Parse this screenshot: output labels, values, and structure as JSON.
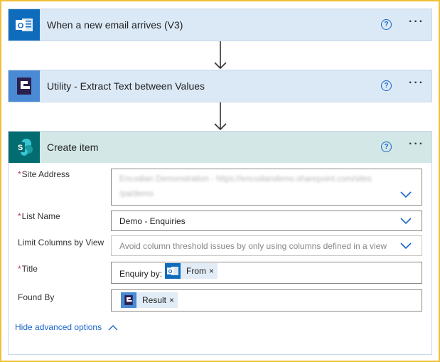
{
  "steps": [
    {
      "title": "When a new email arrives (V3)",
      "icon": "outlook-icon",
      "header_color": "#d5e6f7",
      "icon_bg": "#0f6cbd"
    },
    {
      "title": "Utility - Extract Text between Values",
      "icon": "encodian-icon",
      "header_color": "#d5e6f7",
      "icon_bg": "#4a8ad4"
    },
    {
      "title": "Create item",
      "icon": "sharepoint-icon",
      "header_color": "#d3e8e6",
      "icon_bg": "#036c70"
    }
  ],
  "help_glyph": "?",
  "more_glyph": "···",
  "form": {
    "site_address": {
      "label": "Site Address",
      "value_line1": "Encodian Demonstration - https://encodiandemo.sharepoint.com/sites",
      "value_line2": "/pa/demo"
    },
    "list_name": {
      "label": "List Name",
      "value": "Demo - Enquiries"
    },
    "limit_columns": {
      "label": "Limit Columns by View",
      "placeholder": "Avoid column threshold issues by only using columns defined in a view"
    },
    "title": {
      "label": "Title",
      "prefix": "Enquiry by:",
      "token": "From",
      "token_icon": "outlook-icon"
    },
    "found_by": {
      "label": "Found By",
      "token": "Result",
      "token_icon": "encodian-icon"
    },
    "required_mark": "*",
    "token_close": "×",
    "advanced_toggle": "Hide advanced options"
  },
  "colors": {
    "accent": "#1a66c9",
    "required": "#c4314b",
    "border": "#f2c037"
  }
}
